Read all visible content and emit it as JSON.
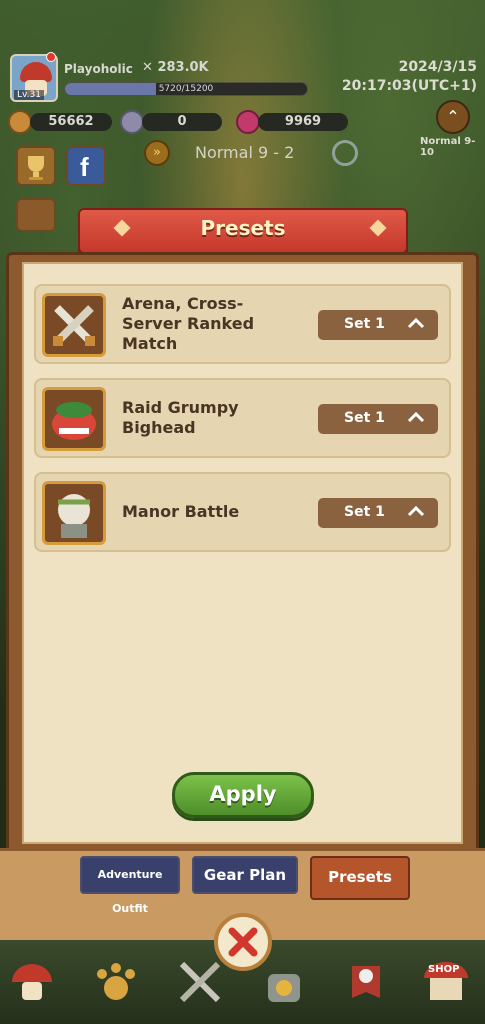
{
  "player": {
    "name": "Playoholic",
    "level": "Lv.31",
    "power": "283.0K",
    "xp_text": "5720/15200",
    "xp_fraction": 0.376
  },
  "datetime": {
    "date": "2024/3/15",
    "time": "20:17:03(UTC+1)"
  },
  "resources": {
    "gold": "56662",
    "crystal": "0",
    "gem": "9969"
  },
  "stage": {
    "label": "Normal 9 - 2",
    "side_label": "Normal 9-10"
  },
  "panel": {
    "title": "Presets",
    "rows": [
      {
        "label": "Arena, Cross-Server Ranked Match",
        "set_label": "Set 1",
        "icon": "crossed-swords-icon"
      },
      {
        "label": "Raid Grumpy Bighead",
        "set_label": "Set 1",
        "icon": "grumpy-bighead-icon"
      },
      {
        "label": "Manor Battle",
        "set_label": "Set 1",
        "icon": "manor-knight-icon"
      }
    ],
    "apply_label": "Apply"
  },
  "tabs": [
    {
      "label": "Adventure Outfit",
      "active": false
    },
    {
      "label": "Gear Plan",
      "active": false
    },
    {
      "label": "Presets",
      "active": true
    }
  ],
  "shop_label": "SHOP",
  "colors": {
    "accent_red": "#c5382b",
    "apply_green": "#5fa834",
    "panel_bg": "#efe2c3",
    "tab_active": "#b5552c",
    "tab_inactive": "#39406b"
  }
}
